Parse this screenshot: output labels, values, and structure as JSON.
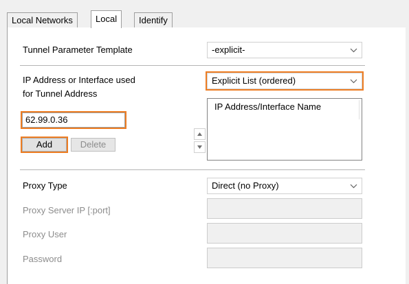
{
  "tabs": [
    {
      "label": "Local Networks",
      "active": false
    },
    {
      "label": "Local",
      "active": true
    },
    {
      "label": "Identify",
      "active": false
    }
  ],
  "tunnel_template": {
    "label": "Tunnel Parameter Template",
    "value": "-explicit-"
  },
  "tunnel_address": {
    "label_line1": "IP Address or Interface used",
    "label_line2": "for Tunnel Address",
    "mode_value": "Explicit List (ordered)",
    "input_value": "62.99.0.36",
    "add_label": "Add",
    "delete_label": "Delete",
    "list_header": "IP Address/Interface Name"
  },
  "proxy": {
    "type_label": "Proxy Type",
    "type_value": "Direct (no Proxy)",
    "server_label": "Proxy Server IP [:port]",
    "user_label": "Proxy User",
    "password_label": "Password"
  },
  "colors": {
    "highlight": "#ee7d22"
  },
  "icons": {
    "dropdown": "chevron-down-icon",
    "spin_up": "triangle-up-icon",
    "spin_down": "triangle-down-icon"
  }
}
